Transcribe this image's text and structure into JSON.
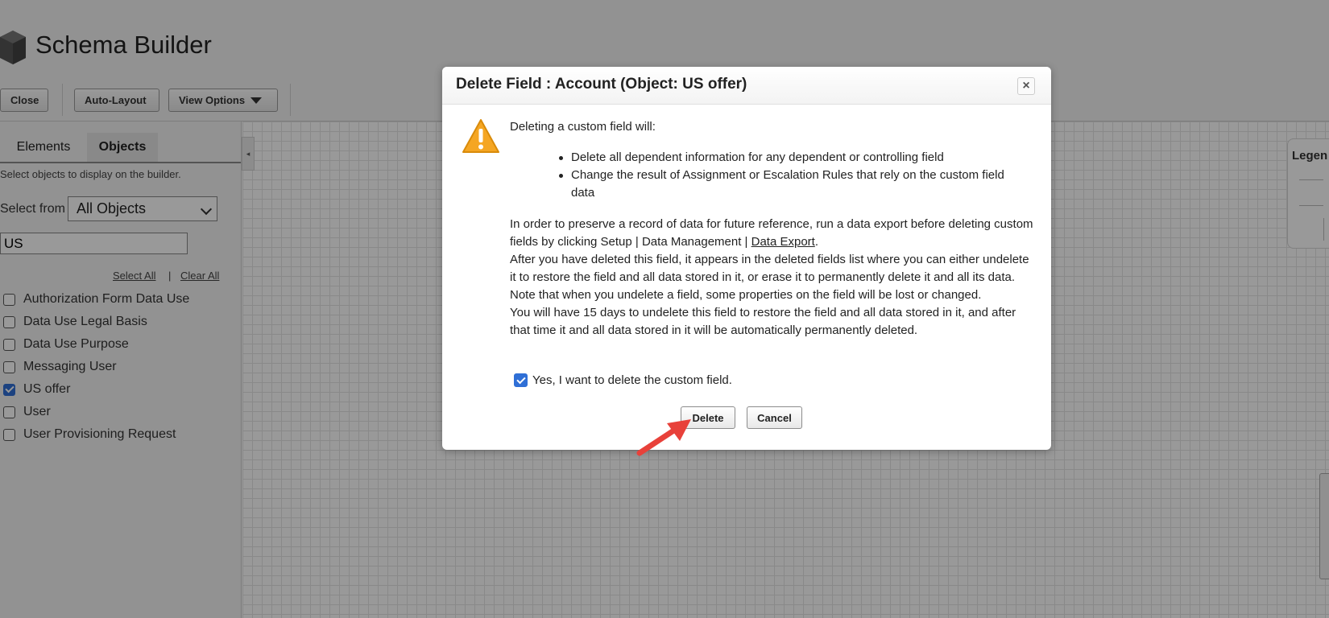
{
  "app": {
    "title": "Schema Builder"
  },
  "toolbar": {
    "close_label": "Close",
    "auto_layout_label": "Auto-Layout",
    "view_options_label": "View Options"
  },
  "sidebar": {
    "tabs": [
      {
        "label": "Elements",
        "active": false
      },
      {
        "label": "Objects",
        "active": true
      }
    ],
    "hint": "Select objects to display on the builder.",
    "select_from_label": "Select from",
    "select_from_value": "All Objects",
    "search_value": "US",
    "select_all_label": "Select All",
    "separator": "|",
    "clear_all_label": "Clear All",
    "objects": [
      {
        "label": "Authorization Form Data Use",
        "checked": false
      },
      {
        "label": "Data Use Legal Basis",
        "checked": false
      },
      {
        "label": "Data Use Purpose",
        "checked": false
      },
      {
        "label": "Messaging User",
        "checked": false
      },
      {
        "label": "US offer",
        "checked": true
      },
      {
        "label": "User",
        "checked": false
      },
      {
        "label": "User Provisioning Request",
        "checked": false
      }
    ]
  },
  "legend": {
    "title": "Legen"
  },
  "modal": {
    "title": "Delete Field : Account (Object: US offer)",
    "close_symbol": "×",
    "intro": "Deleting a custom field will:",
    "bullets": [
      "Delete all dependent information for any dependent or controlling field",
      "Change the result of Assignment or Escalation Rules that rely on the custom field data"
    ],
    "para1_text": "In order to preserve a record of data for future reference, run a data export before deleting custom fields by clicking Setup | Data Management | ",
    "para1_link": "Data Export",
    "para1_end": ".",
    "para2": "After you have deleted this field, it appears in the deleted fields list where you can either undelete it to restore the field and all data stored in it, or erase it to permanently delete it and all its data. Note that when you undelete a field, some properties on the field will be lost or changed.",
    "para3": "You will have 15 days to undelete this field to restore the field and all data stored in it, and after that time it and all data stored in it will be automatically permanently deleted.",
    "confirm_label": "Yes, I want to delete the custom field.",
    "confirm_checked": true,
    "delete_label": "Delete",
    "cancel_label": "Cancel"
  },
  "colors": {
    "overlay": "#000000",
    "checkbox_checked": "#2f6fd6",
    "warning": "#f5a623",
    "arrow": "#e8413a"
  }
}
